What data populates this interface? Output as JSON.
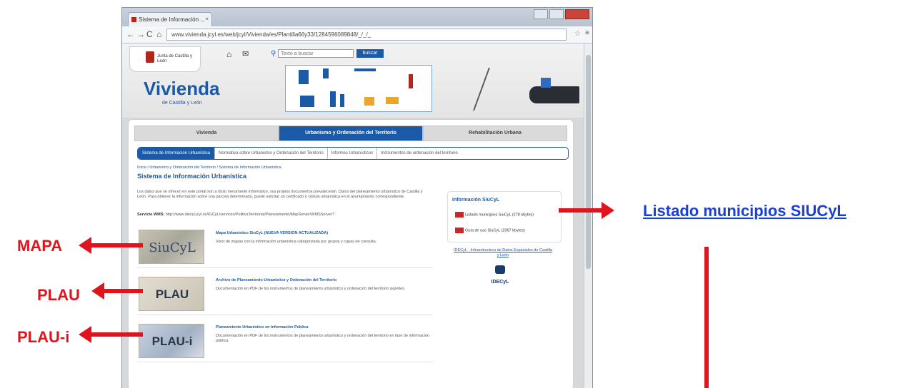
{
  "annotations": {
    "mapa_label": "MAPA",
    "plau_label": "PLAU",
    "plaui_label": "PLAU-i",
    "listado_link": "Listado municipios SIUCyL"
  },
  "browser": {
    "tab_title": "Sistema de Información ...",
    "tab_close": "×",
    "url": "www.vivienda.jcyl.es/web/jcyl/Vivienda/es/Plantilla66y33/1284596089848/_/_/_",
    "menu_glyph": "≡"
  },
  "site": {
    "logo_text": "Junta de Castilla y León",
    "search_placeholder": "Texto a buscar",
    "search_button": "buscar",
    "title": "Vivienda",
    "subtitle": "de Castilla y León"
  },
  "mainnav": [
    "Vivienda",
    "Urbanismo y Ordenación del Territorio",
    "Rehabilitación Urbana"
  ],
  "subnav": {
    "active": "Sistema de Información Urbanística",
    "items": [
      "Normativa sobre Urbanismo y Ordenación del Territorio",
      "Informes Urbanísticos",
      "Instrumentos de ordenación del territorio"
    ]
  },
  "breadcrumb": "Inicio / Urbanismo y Ordenación del Territorio / Sistema de Información Urbanística",
  "page_title": "Sistema de Información Urbanística",
  "intro": "Los datos que se ofrecen en este portal son a título meramente informativo, sus propios documentos prevalecerán. Datos del planeamiento urbanístico de Castilla y León. Para obtener la información sobre una parcela determinada, puede solicitar un certificado o cédula urbanística en el ayuntamiento correspondiente.",
  "wms": {
    "label": "Servicio WMS:",
    "url": "http://www.idecyl.jcyl.es/IGCyL/services/PoliticaTerritorial/Planeamiento/MapServer/WMSServer?"
  },
  "entries": [
    {
      "thumb": "SiuCyL",
      "title": "Mapa Urbanístico SiuCyL (NUEVA VERSIÓN ACTUALIZADA)",
      "desc": "Visor de mapas con la información urbanística categorizada por grupos y capas de consulta."
    },
    {
      "thumb": "PLAU",
      "title": "Archivo de Planeamiento Urbanístico y Ordenación del Territorio",
      "desc": "Documentación en PDF de los instrumentos de planeamiento urbanístico y ordenación del territorio vigentes."
    },
    {
      "thumb": "PLAU-i",
      "title": "Planeamiento Urbanístico en Información Pública",
      "desc": "Documentación en PDF de los instrumentos de planeamiento urbanístico y ordenación del territorio en fase de información pública."
    }
  ],
  "side": {
    "title": "Información SiuCyL",
    "links": [
      "Listado municipios SiuCyL (278 kbytes)",
      "Guía de uso SiuCyL (2067 kbytes)"
    ],
    "ide_link": "IDECyL - Infraestructura de Datos Espaciales de Castilla y León",
    "ide_logo": "IDECyL"
  },
  "colors": {
    "annotation_red": "#e0141c",
    "link_blue": "#1a3fd6",
    "brand_blue": "#1b5aa6"
  },
  "icons": [
    "back-icon",
    "forward-icon",
    "reload-icon",
    "home-icon",
    "mail-icon",
    "search-icon",
    "star-icon",
    "pdf-icon"
  ]
}
